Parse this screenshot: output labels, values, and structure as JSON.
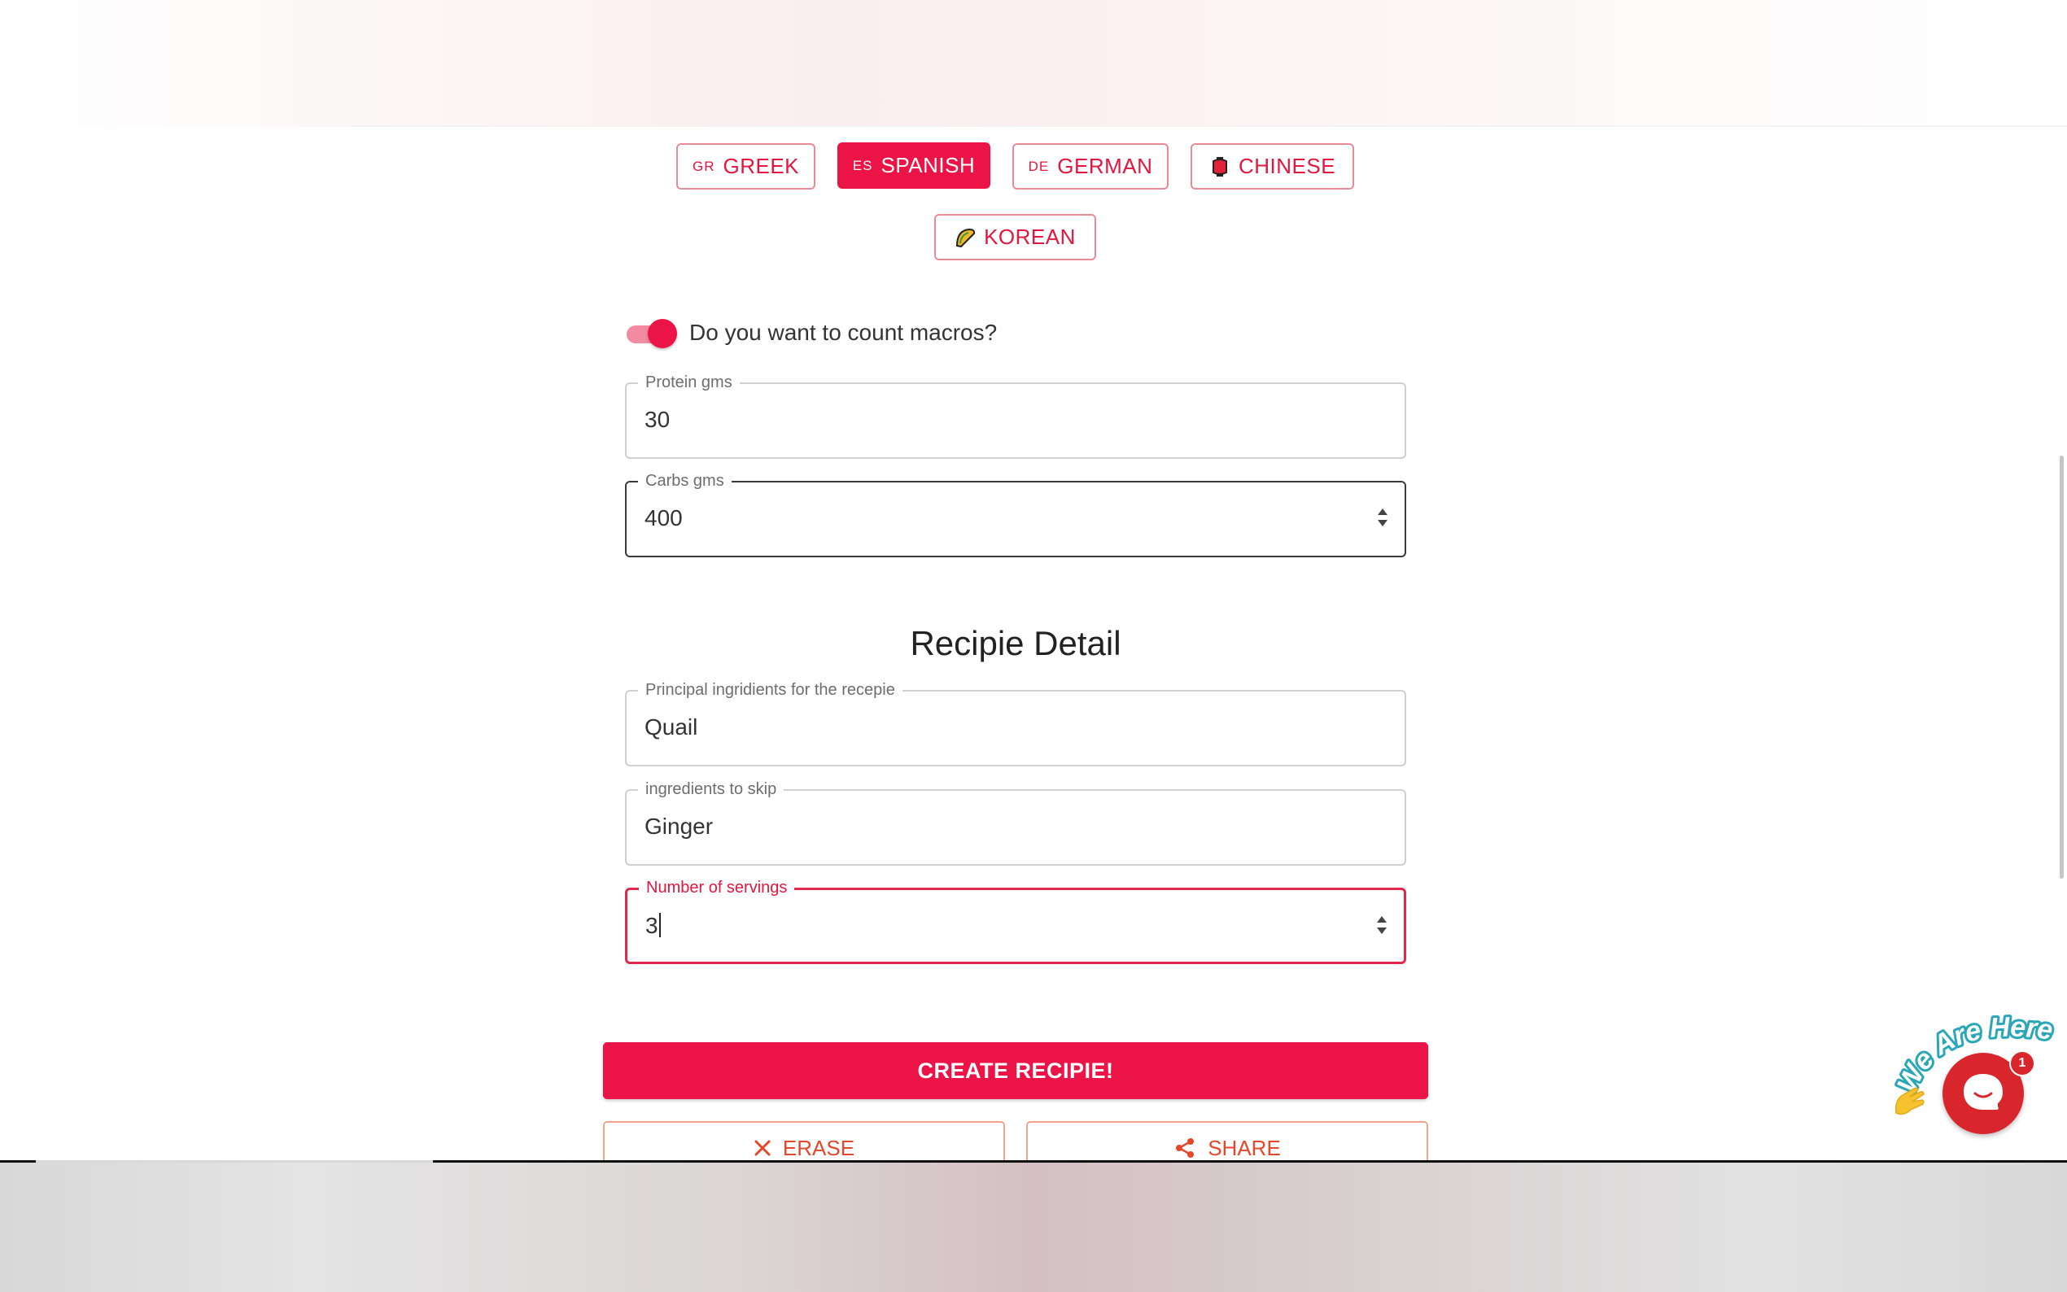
{
  "cuisines": [
    {
      "code": "GR",
      "label": "GREEK",
      "selected": false
    },
    {
      "code": "ES",
      "label": "SPANISH",
      "selected": true
    },
    {
      "code": "DE",
      "label": "GERMAN",
      "selected": false
    },
    {
      "code": "",
      "icon": "lantern-icon",
      "label": "CHINESE",
      "selected": false
    },
    {
      "code": "",
      "icon": "taco-icon",
      "label": "KOREAN",
      "selected": false
    }
  ],
  "macros": {
    "question": "Do you want to count macros?",
    "enabled": true,
    "protein": {
      "label": "Protein gms",
      "value": "30"
    },
    "carbs": {
      "label": "Carbs gms",
      "value": "400"
    }
  },
  "recipe_detail": {
    "title": "Recipie Detail",
    "principal": {
      "label": "Principal ingridients for the recepie",
      "value": "Quail"
    },
    "skip": {
      "label": "ingredients to skip",
      "value": "Ginger"
    },
    "servings": {
      "label": "Number of servings",
      "value": "3"
    }
  },
  "actions": {
    "create": "CREATE RECIPIE!",
    "erase": "ERASE",
    "share": "SHARE"
  },
  "chat": {
    "banner": "We Are Here!",
    "badge": "1"
  },
  "colors": {
    "accent": "#ec1447",
    "secondary": "#e4482a",
    "chat_red": "#d8262c",
    "chat_teal": "#2aa6b7"
  }
}
